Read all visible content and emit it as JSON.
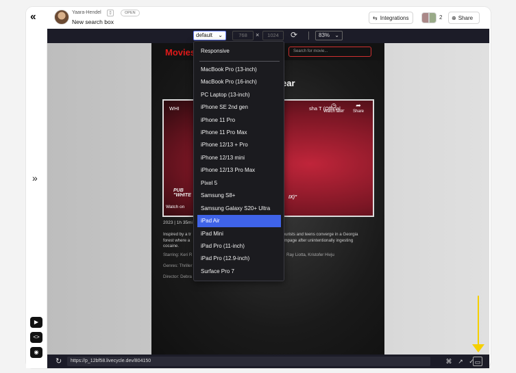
{
  "header": {
    "user_name": "Yaara-Hendel",
    "project_title": "New search box",
    "status_badge": "OPEN",
    "integrations_label": "Integrations",
    "collaborator_count": "2",
    "share_label": "Share"
  },
  "device_toolbar": {
    "device_selected": "default",
    "width": "768",
    "height": "1024",
    "dim_separator": "×",
    "zoom": "83%"
  },
  "dropdown": {
    "options": [
      "Responsive",
      "MacBook Pro (13-inch)",
      "MacBook Pro (16-inch)",
      "PC Laptop (13-inch)",
      "iPhone SE 2nd gen",
      "iPhone 11 Pro",
      "iPhone 11 Pro Max",
      "iPhone 12/13 + Pro",
      "iPhone 12/13 mini",
      "iPhone 12/13 Pro Max",
      "Pixel 5",
      "Samsung S8+",
      "Samsung Galaxy S20+ Ultra",
      "iPad Air",
      "iPad Mini",
      "iPad Pro (11-inch)",
      "iPad Pro (12.9-inch)",
      "Surface Pro 7"
    ],
    "selected": "iPad Air"
  },
  "site": {
    "logo": "Movies",
    "search_placeholder": "Search for movie...",
    "heading_fragment": "ear",
    "video_title_left": "WHI",
    "video_title_right": "sha T (Official...",
    "watch_later": "Watch later",
    "share": "Share",
    "watch_on": "Watch on",
    "overlay_left": "PUB\n\"WHITE",
    "overlay_right": "IX)\"",
    "meta_year": "2023",
    "meta_runtime": "1h 35mi",
    "desc_left_1": "Inspired by a tr",
    "desc_left_2": "forest where a",
    "desc_left_3": "cocaine.",
    "desc_right_1": "tourists and teens converge in a Georgia",
    "desc_right_2": "ampage after unintentionally ingesting",
    "starring_label": "Starring: Keri R",
    "starring_right": "Ray Liotta, Kristofer Hivju",
    "genres_label": "Genres: Thriller",
    "director_label": "Director: Debra"
  },
  "bottom_bar": {
    "url": "https://p_12bf58.livecycle.dev/804150"
  },
  "colors": {
    "toolbar_bg": "#1c1c28",
    "selected_blue": "#3f63e8",
    "annotation_yellow": "#f5d000",
    "brand_red": "#e01a1a"
  }
}
